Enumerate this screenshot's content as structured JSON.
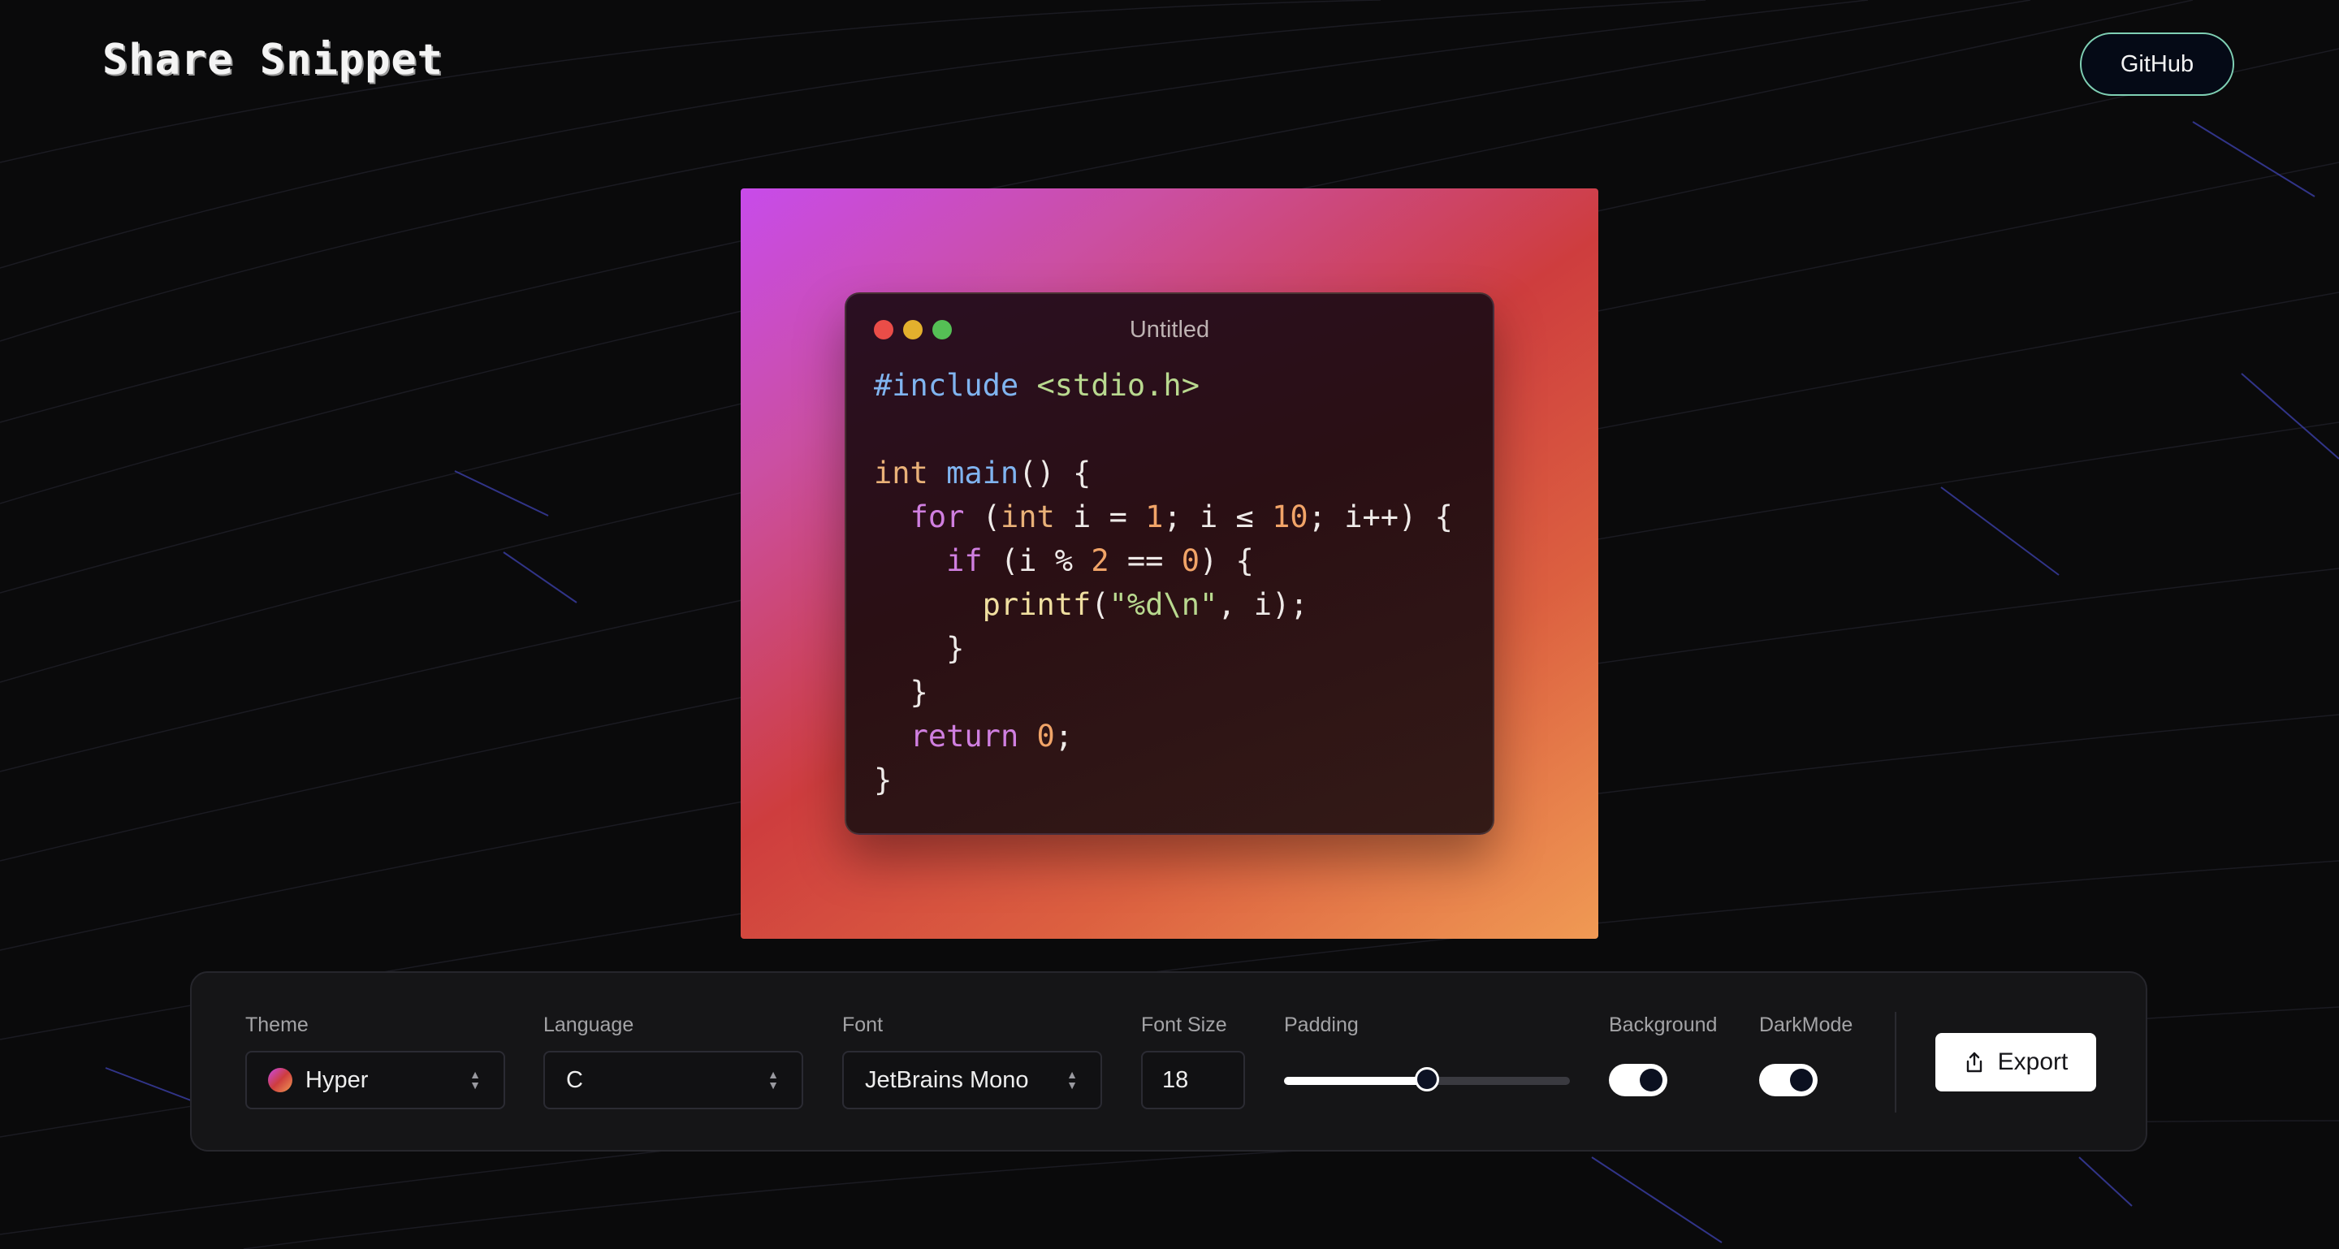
{
  "header": {
    "logo": "Share Snippet",
    "github_label": "GitHub"
  },
  "window": {
    "title": "Untitled",
    "code_lines": [
      [
        {
          "t": "#include",
          "c": "pp"
        },
        {
          "t": " "
        },
        {
          "t": "<stdio.h>",
          "c": "st"
        }
      ],
      [],
      [
        {
          "t": "int",
          "c": "ty"
        },
        {
          "t": " "
        },
        {
          "t": "main",
          "c": "fn"
        },
        {
          "t": "() {"
        }
      ],
      [
        {
          "t": "  "
        },
        {
          "t": "for",
          "c": "kw"
        },
        {
          "t": " ("
        },
        {
          "t": "int",
          "c": "ty"
        },
        {
          "t": " i = "
        },
        {
          "t": "1",
          "c": "nm"
        },
        {
          "t": "; i ≤ "
        },
        {
          "t": "10",
          "c": "nm"
        },
        {
          "t": "; i++) {"
        }
      ],
      [
        {
          "t": "    "
        },
        {
          "t": "if",
          "c": "kw"
        },
        {
          "t": " (i % "
        },
        {
          "t": "2",
          "c": "nm"
        },
        {
          "t": " == "
        },
        {
          "t": "0",
          "c": "nm"
        },
        {
          "t": ") {"
        }
      ],
      [
        {
          "t": "      "
        },
        {
          "t": "printf",
          "c": "pf"
        },
        {
          "t": "("
        },
        {
          "t": "\"%d\\n\"",
          "c": "st"
        },
        {
          "t": ", i);"
        }
      ],
      [
        {
          "t": "    }"
        }
      ],
      [
        {
          "t": "  }"
        }
      ],
      [
        {
          "t": "  "
        },
        {
          "t": "return",
          "c": "kw"
        },
        {
          "t": " "
        },
        {
          "t": "0",
          "c": "nm"
        },
        {
          "t": ";"
        }
      ],
      [
        {
          "t": "}"
        }
      ]
    ]
  },
  "toolbar": {
    "theme_label": "Theme",
    "theme_value": "Hyper",
    "language_label": "Language",
    "language_value": "C",
    "font_label": "Font",
    "font_value": "JetBrains Mono",
    "fontsize_label": "Font Size",
    "fontsize_value": "18",
    "padding_label": "Padding",
    "padding_level": 0.5,
    "background_label": "Background",
    "background_on": true,
    "darkmode_label": "DarkMode",
    "darkmode_on": true,
    "export_label": "Export"
  },
  "icons": {
    "select_chevrons": "chevron-up-down-icon",
    "export": "share-icon",
    "traffic_lights": [
      "close-dot",
      "minimize-dot",
      "maximize-dot"
    ]
  },
  "colors": {
    "background": "#0a0a0b",
    "canvas_gradient": [
      "#c84bea",
      "#ce3d3e",
      "#f09a54"
    ],
    "github_border": "#7fd0b4"
  }
}
